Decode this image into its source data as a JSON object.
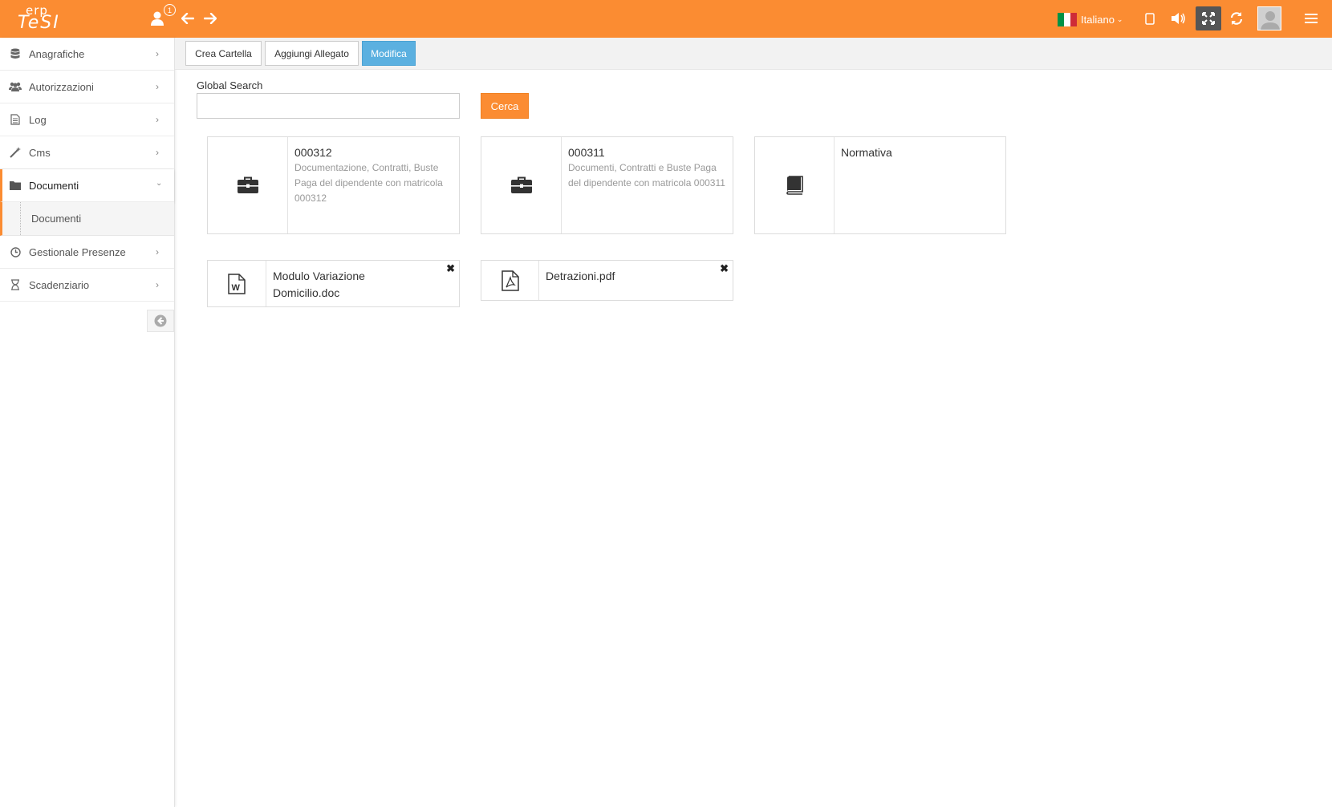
{
  "header": {
    "logo_top": "erp",
    "logo_bottom": "TeSI",
    "user_badge_count": "1",
    "language": "Italiano",
    "flag_colors": [
      "#009246",
      "#ffffff",
      "#ce2b37"
    ],
    "accent": "#fb8c32"
  },
  "sidebar": {
    "items": [
      {
        "label": "Anagrafiche",
        "icon": "database-icon"
      },
      {
        "label": "Autorizzazioni",
        "icon": "users-icon"
      },
      {
        "label": "Log",
        "icon": "file-text-icon"
      },
      {
        "label": "Cms",
        "icon": "magic-wand-icon"
      },
      {
        "label": "Documenti",
        "icon": "folder-icon",
        "expanded": true
      },
      {
        "label": "Gestionale Presenze",
        "icon": "clock-icon"
      },
      {
        "label": "Scadenziario",
        "icon": "hourglass-icon"
      }
    ],
    "sub_items": [
      {
        "label": "Documenti"
      }
    ]
  },
  "toolbar": {
    "create_folder": "Crea Cartella",
    "add_attachment": "Aggiungi Allegato",
    "edit": "Modifica"
  },
  "search": {
    "label": "Global Search",
    "value": "",
    "button": "Cerca"
  },
  "folders": [
    {
      "title": "000312",
      "description": "Documentazione, Contratti, Buste Paga del dipendente con matricola 000312",
      "icon": "briefcase-icon"
    },
    {
      "title": "000311",
      "description": "Documenti, Contratti e Buste Paga del dipendente con matricola 000311",
      "icon": "briefcase-icon"
    },
    {
      "title": "Normativa",
      "description": "",
      "icon": "book-icon"
    }
  ],
  "files": [
    {
      "name_line1": "Modulo Variazione",
      "name_line2": "Domicilio.doc",
      "icon": "word-file-icon"
    },
    {
      "name_line1": "Detrazioni.pdf",
      "name_line2": "",
      "icon": "pdf-file-icon"
    }
  ],
  "colors": {
    "header_bg": "#fb8c32",
    "primary_button": "#5bb0e0",
    "search_button": "#fb8c32"
  }
}
